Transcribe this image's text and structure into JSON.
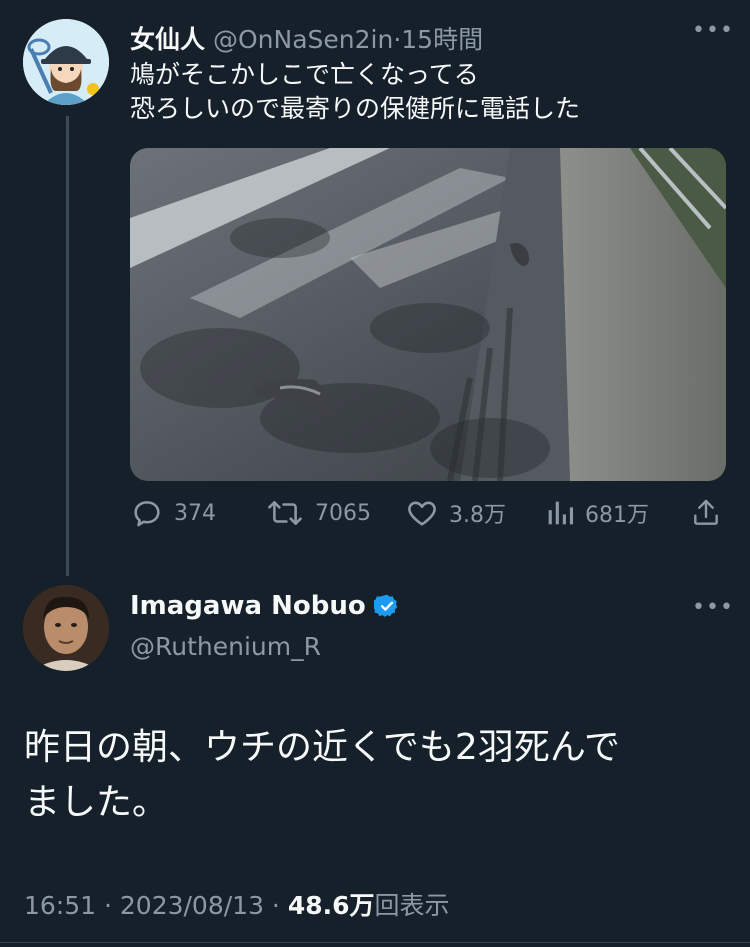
{
  "tweet1": {
    "author_name": "女仙人",
    "handle": "@OnNaSen2in",
    "separator": "·",
    "time": "15時間",
    "text_line1": "鳩がそこかしこで亡くなってる",
    "text_line2": "恐ろしいので最寄りの保健所に電話した",
    "more": "•••",
    "metrics": {
      "replies": "374",
      "retweets": "7065",
      "likes": "3.8万",
      "views": "681万"
    },
    "icons": [
      "reply-icon",
      "retweet-icon",
      "like-icon",
      "views-icon",
      "share-icon"
    ]
  },
  "tweet2": {
    "author_name": "Imagawa Nobuo",
    "verified_icon": "verified-badge-icon",
    "handle": "@Ruthenium_R",
    "more": "•••",
    "text_line1": "昨日の朝、ウチの近くでも2羽死んで",
    "text_line2": "ました。",
    "timestamp": "16:51 · 2023/08/13 · ",
    "views_count": "48.6万",
    "views_label": "回表示"
  },
  "colors": {
    "background": "#15202b",
    "text": "#f7f9f9",
    "muted": "#8b98a5",
    "verified": "#1d9bf0",
    "thread_line": "#3d4b57"
  }
}
